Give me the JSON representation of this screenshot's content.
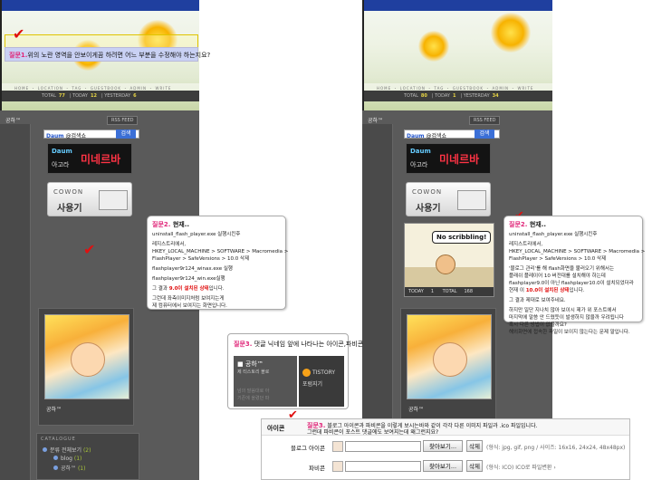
{
  "left": {
    "question1": {
      "num": "질문1.",
      "text": "위의 노란 영역을 안보이게끔 하려면 어느 부분을 수정해야 하는지요?"
    },
    "nav": "HOME ・ LOCATION ・ TAG ・ GUESTBOOK ・ ADMIN ・ WRITE",
    "counter": {
      "total_label": "TOTAL",
      "total": "77",
      "today_label": "TODAY",
      "today": "12",
      "yesterday_label": "YESTERDAY",
      "yesterday": "6"
    },
    "site_label": "공하™",
    "rss": "RSS FEED",
    "search": {
      "brand": "Daum",
      "query": "@검색쇼",
      "button": "검색"
    },
    "daum_banner": {
      "logo": "Daum",
      "sub": "아고라",
      "big": "미네르바"
    },
    "cowon": {
      "brand": "COWON",
      "use": "사용기"
    },
    "profile_name": "공하™",
    "catalogue": {
      "title": "CATALOGUE",
      "rows": [
        {
          "label": "분류 전체보기",
          "count": "(2)"
        },
        {
          "label": "blog",
          "count": "(1)"
        },
        {
          "label": "공하™",
          "count": "(1)"
        }
      ]
    }
  },
  "right": {
    "nav": "HOME ・ LOCATION ・ TAG ・ GUESTBOOK ・ ADMIN ・ WRITE",
    "counter": {
      "total_label": "TOTAL",
      "total": "80",
      "today_label": "TODAY",
      "today": "1",
      "yesterday_label": "YESTERDAY",
      "yesterday": "34"
    },
    "site_label": "공하™",
    "rss": "RSS FEED",
    "search": {
      "brand": "Daum",
      "query": "@검색쇼",
      "button": "검색"
    },
    "daum_banner": {
      "logo": "Daum",
      "sub": "아고라",
      "big": "미네르바"
    },
    "cowon": {
      "brand": "COWON",
      "use": "사용기"
    },
    "flash": {
      "bubble": "No scribbling!",
      "today_label": "TODAY",
      "today": "1",
      "total_label": "TOTAL",
      "total": "168"
    },
    "profile_name": "공하™"
  },
  "q2left": {
    "num": "질문2.",
    "title": " 현재..",
    "lines": [
      "uninstall_flash_player.exe 실행시킨후",
      "레지스트리에서,",
      "HKEY_LOCAL_MACHINE > SOFTWARE > Macromedia >",
      "FlashPlayer > SafeVersions > 10.0 삭제",
      "flashplayer9r124_winax.exe 실행",
      "flashplayer9r124_win.exe실행"
    ],
    "result_pre": "그 결과 ",
    "result_red": "9.0이 설치된 상태",
    "result_post": "입니다.",
    "tail1": "그런데 좌측이미지처럼 보여지는게",
    "tail2": "제 컴퓨터에서 보여지는 화면입니다."
  },
  "q2right": {
    "num": "질문2.",
    "title": " 현재..",
    "lines": [
      "uninstall_flash_player.exe 실행시킨후",
      "레지스트리에서,",
      "HKEY_LOCAL_MACHINE > SOFTWARE > Macromedia >",
      "FlashPlayer > SafeVersions > 10.0 삭제"
    ],
    "body1": "'블로그 관리'를 해 flash화면을 불러오기 위해서는",
    "body2": "플래쉬 플레이어 10 버전대를 설치해야 하는데",
    "body3": "flashplayer9.0이 아닌 flashplayer10.0이 설치되었더라",
    "body4_pre": "현재 이 ",
    "body4_red": "10.0이 설치된 상태",
    "body4_post": "입니다.",
    "body5": "그 결과 제대로 보여주네요.",
    "body6": "하지만 일단 지나치 않아 보이시 제가 위 포스트에서",
    "body7": "마지막에 말씀 안 드렸듯이 발생하지 않을까 우려됩니다",
    "body8": "혹시 다른 방법이 없을까요?",
    "body9": "해외화면에 접속한 파일이 보이지 않는다는 문제 말입니다."
  },
  "q3left": {
    "num": "질문3.",
    "title": " 댓글 닉네임 앞에 나타나는 아이콘,파비콘",
    "tile_name": "공하™",
    "tile_line": "제 티스토리 블로",
    "tile_muted1": "넘의 말씀대로 아",
    "tile_muted2": "기존에 올렸던 파",
    "tistory_text": "TISTORY",
    "tistory_sub": "포럼지기"
  },
  "q3right": {
    "label": "아이콘",
    "num": "질문3.",
    "q_line1": "블로그 아이콘과 파비콘을 이렇게 보시는바와 같이 각각 다른 이미지 파일과 .ico 파일입니다.",
    "q_line2": "그런데 파비콘이 포스트 댓글에도 보여지는데 왜그런지요?",
    "rows": [
      {
        "label": "블로그 아이콘",
        "browse": "찾아보기...",
        "delete": "삭제",
        "format": "(형식: jpg, gif, png / 사이즈: 16x16, 24x24, 48x48px)"
      },
      {
        "label": "파비콘",
        "browse": "찾아보기...",
        "delete": "삭제",
        "format": "(형식: ICO) ICO로 파일변환 ›"
      }
    ]
  }
}
